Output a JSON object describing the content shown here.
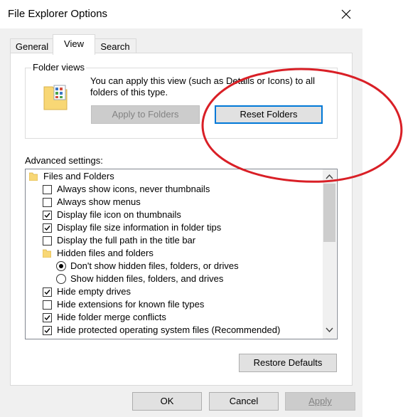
{
  "window": {
    "title": "File Explorer Options"
  },
  "tabs": [
    {
      "label": "General"
    },
    {
      "label": "View"
    },
    {
      "label": "Search"
    }
  ],
  "folder_views": {
    "group_label": "Folder views",
    "description": "You can apply this view (such as Details or Icons) to all folders of this type.",
    "apply_label": "Apply to Folders",
    "reset_label": "Reset Folders"
  },
  "advanced": {
    "label": "Advanced settings:",
    "category": "Files and Folders",
    "items": [
      {
        "label": "Always show icons, never thumbnails",
        "checked": false
      },
      {
        "label": "Always show menus",
        "checked": false
      },
      {
        "label": "Display file icon on thumbnails",
        "checked": true
      },
      {
        "label": "Display file size information in folder tips",
        "checked": true
      },
      {
        "label": "Display the full path in the title bar",
        "checked": false
      }
    ],
    "hidden_group": "Hidden files and folders",
    "radios": [
      {
        "label": "Don't show hidden files, folders, or drives",
        "selected": true
      },
      {
        "label": "Show hidden files, folders, and drives",
        "selected": false
      }
    ],
    "items2": [
      {
        "label": "Hide empty drives",
        "checked": true
      },
      {
        "label": "Hide extensions for known file types",
        "checked": false
      },
      {
        "label": "Hide folder merge conflicts",
        "checked": true
      },
      {
        "label": "Hide protected operating system files (Recommended)",
        "checked": true
      }
    ]
  },
  "restore_label": "Restore Defaults",
  "footer": {
    "ok": "OK",
    "cancel": "Cancel",
    "apply": "Apply"
  },
  "colors": {
    "annotation": "#d91f26",
    "focus": "#0078d7"
  }
}
